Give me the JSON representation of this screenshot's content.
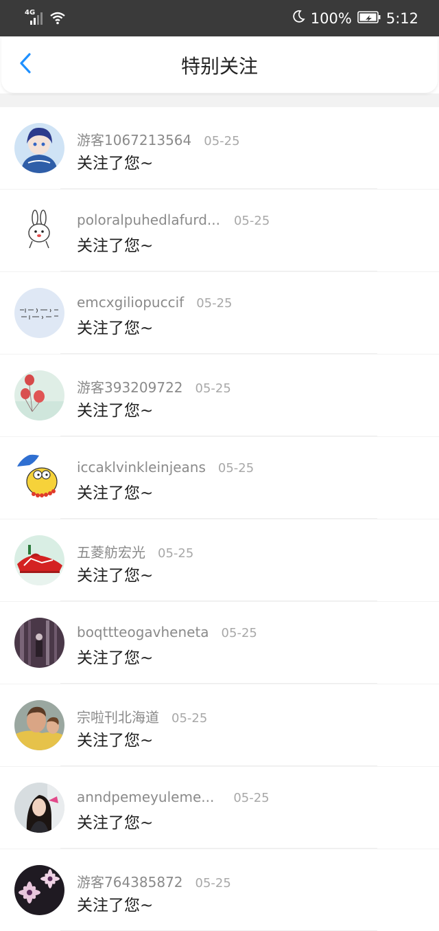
{
  "status_bar": {
    "network_type": "4G",
    "battery_percent": "100%",
    "time": "5:12",
    "icons": [
      "signal-icon",
      "wifi-icon",
      "moon-icon",
      "battery-icon"
    ]
  },
  "header": {
    "title": "特别关注",
    "back_icon": "chevron-left-icon"
  },
  "colors": {
    "status_bar_bg": "#3a3a3a",
    "accent": "#1e90ff",
    "username_text": "#8a8a8a",
    "date_text": "#a8a8a8",
    "message_text": "#1f1f1f"
  },
  "list": {
    "items": [
      {
        "username": "游客1067213564",
        "date": "05-25",
        "message": "关注了您~",
        "avatar": "anime-boy-avatar"
      },
      {
        "username": "poloralpuhedlafurd...",
        "date": "05-25",
        "message": "关注了您~",
        "avatar": "bunny-avatar"
      },
      {
        "username": "emcxgiliopuccif",
        "date": "05-25",
        "message": "关注了您~",
        "avatar": "handwriting-avatar"
      },
      {
        "username": "游客393209722",
        "date": "05-25",
        "message": "关注了您~",
        "avatar": "balloons-avatar"
      },
      {
        "username": "iccaklvinkleinjeans",
        "date": "05-25",
        "message": "关注了您~",
        "avatar": "cartoon-avatar"
      },
      {
        "username": "五菱舫宏光",
        "date": "05-25",
        "message": "关注了您~",
        "avatar": "red-car-avatar"
      },
      {
        "username": "boqttteogavheneta",
        "date": "05-25",
        "message": "关注了您~",
        "avatar": "dark-photo-avatar"
      },
      {
        "username": "宗啦刊北海道",
        "date": "05-25",
        "message": "关注了您~",
        "avatar": "man-photo-avatar"
      },
      {
        "username": "anndpemeyuleme...",
        "date": "05-25",
        "message": "关注了您~",
        "avatar": "woman-photo-avatar"
      },
      {
        "username": "游客764385872",
        "date": "05-25",
        "message": "关注了您~",
        "avatar": "flowers-avatar"
      }
    ]
  }
}
